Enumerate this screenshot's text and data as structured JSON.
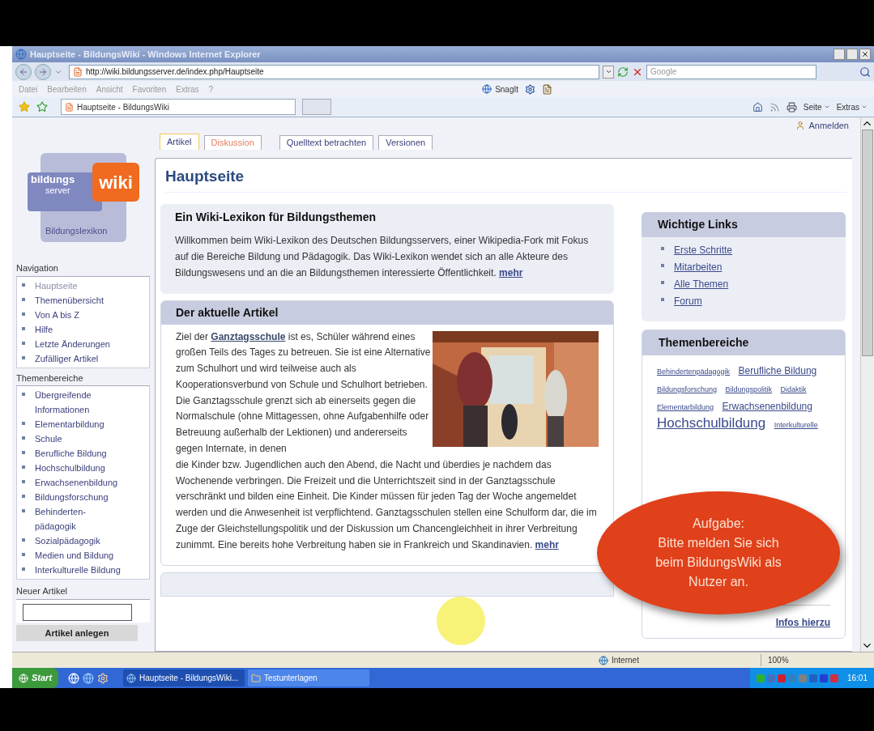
{
  "browser": {
    "title": "Hauptseite - BildungsWiki - Windows Internet Explorer",
    "url": "http://wiki.bildungsserver.de/index.php/Hauptseite",
    "search_placeholder": "Google",
    "menu": [
      "Datei",
      "Bearbeiten",
      "Ansicht",
      "Favoriten",
      "Extras",
      "?"
    ],
    "snagit": "SnagIt",
    "tab": "Hauptseite - BildungsWiki",
    "toolbar": [
      "Seite",
      "Extras"
    ]
  },
  "page": {
    "login": "Anmelden",
    "tabs": [
      {
        "label": "Artikel",
        "selected": true,
        "missing": false
      },
      {
        "label": "Diskussion",
        "selected": false,
        "missing": true
      },
      {
        "label": "Quelltext betrachten",
        "selected": false,
        "missing": false
      },
      {
        "label": "Versionen",
        "selected": false,
        "missing": false
      }
    ],
    "title": "Hauptseite",
    "logo": {
      "line1": "bildungs",
      "line2": "server",
      "wiki": "wiki",
      "caption": "Bildungslexikon"
    },
    "sidebar": [
      {
        "title": "Navigation",
        "items": [
          {
            "label": "Hauptseite",
            "current": true
          },
          {
            "label": "Themenübersicht",
            "current": false
          },
          {
            "label": "Von A bis Z",
            "current": false
          },
          {
            "label": "Hilfe",
            "current": false
          },
          {
            "label": "Letzte Änderungen",
            "current": false
          },
          {
            "label": "Zufälliger Artikel",
            "current": false
          }
        ]
      },
      {
        "title": "Themenbereiche",
        "items": [
          {
            "label": "Übergreifende Informationen",
            "current": false
          },
          {
            "label": "Elementarbildung",
            "current": false
          },
          {
            "label": "Schule",
            "current": false
          },
          {
            "label": "Berufliche Bildung",
            "current": false
          },
          {
            "label": "Hochschulbildung",
            "current": false
          },
          {
            "label": "Erwachsenenbildung",
            "current": false
          },
          {
            "label": "Bildungsforschung",
            "current": false
          },
          {
            "label": "Behinderten-pädagogik",
            "current": false
          },
          {
            "label": "Sozialpädagogik",
            "current": false
          },
          {
            "label": "Medien und Bildung",
            "current": false
          },
          {
            "label": "Interkulturelle Bildung",
            "current": false
          }
        ]
      }
    ],
    "new_article": {
      "title": "Neuer Artikel",
      "button": "Artikel anlegen"
    },
    "intro": {
      "title": "Ein Wiki-Lexikon für Bildungsthemen",
      "text": "Willkommen beim Wiki-Lexikon des Deutschen Bildungsservers, einer Wikipedia-Fork mit Fokus auf die Bereiche Bildung und Pädagogik. Das Wiki-Lexikon wendet sich an alle Akteure des Bildungswesens und an die an Bildungsthemen interessierte Öffentlichkeit.",
      "more": "mehr"
    },
    "article": {
      "title": "Der aktuelle Artikel",
      "before": "Ziel der",
      "link": "Ganztagsschule",
      "after": "ist es, Schüler während eines großen Teils des Tages zu betreuen. Sie ist eine Alternative zum Schulhort und wird teilweise auch als Kooperationsverbund von Schule und Schulhort betrieben. Die Ganztagsschule grenzt sich ab einerseits gegen die Normalschule (ohne Mittagessen, ohne Aufgabenhilfe oder Betreuung außerhalb der Lektionen) und andererseits gegen Internate, in denen",
      "continued": "die Kinder bzw. Jugendlichen auch den Abend, die Nacht und überdies je nachdem das Wochenende verbringen. Die Freizeit und die Unterrichtszeit sind in der Ganztagsschule verschränkt und bilden eine Einheit. Die Kinder müssen für jeden Tag der Woche angemeldet werden und die Anwesenheit ist verpflichtend. Ganztagsschulen stellen eine Schulform dar, die im Zuge der Gleichstellungspolitik und der Diskussion um Chancengleichheit in ihrer Verbreitung zunimmt. Eine bereits hohe Verbreitung haben sie in Frankreich und Skandinavien.",
      "more": "mehr"
    },
    "links": {
      "title": "Wichtige Links",
      "items": [
        "Erste Schritte",
        "Mitarbeiten",
        "Alle Themen",
        "Forum"
      ]
    },
    "topics": {
      "title": "Themenbereiche",
      "tags": [
        {
          "label": "Behindertenpädagogik",
          "kind": "small"
        },
        {
          "label": "Berufliche Bildung",
          "kind": "medium"
        },
        {
          "label": "Bildungsforschung",
          "kind": "small"
        },
        {
          "label": "Bildungspolitik",
          "kind": "small"
        },
        {
          "label": "Didaktik",
          "kind": "small"
        },
        {
          "label": "Elementarbildung",
          "kind": "small"
        },
        {
          "label": "Erwachsenenbildung",
          "kind": "medium"
        },
        {
          "label": "Hochschulbildung",
          "kind": "large"
        },
        {
          "label": "Interkulturelle",
          "kind": "small"
        }
      ],
      "more": "Infos hierzu"
    },
    "callout": {
      "title": "Aufgabe:",
      "text": "Bitte melden Sie sich beim BildungsWiki als Nutzer an."
    }
  },
  "status": {
    "zone": "Internet",
    "zoom": "100%"
  },
  "taskbar": {
    "start": "Start",
    "tasks": [
      {
        "label": "Hauptseite - BildungsWiki...",
        "active": true
      },
      {
        "label": "Testunterlagen",
        "active": false
      }
    ],
    "clock": "16:01"
  }
}
